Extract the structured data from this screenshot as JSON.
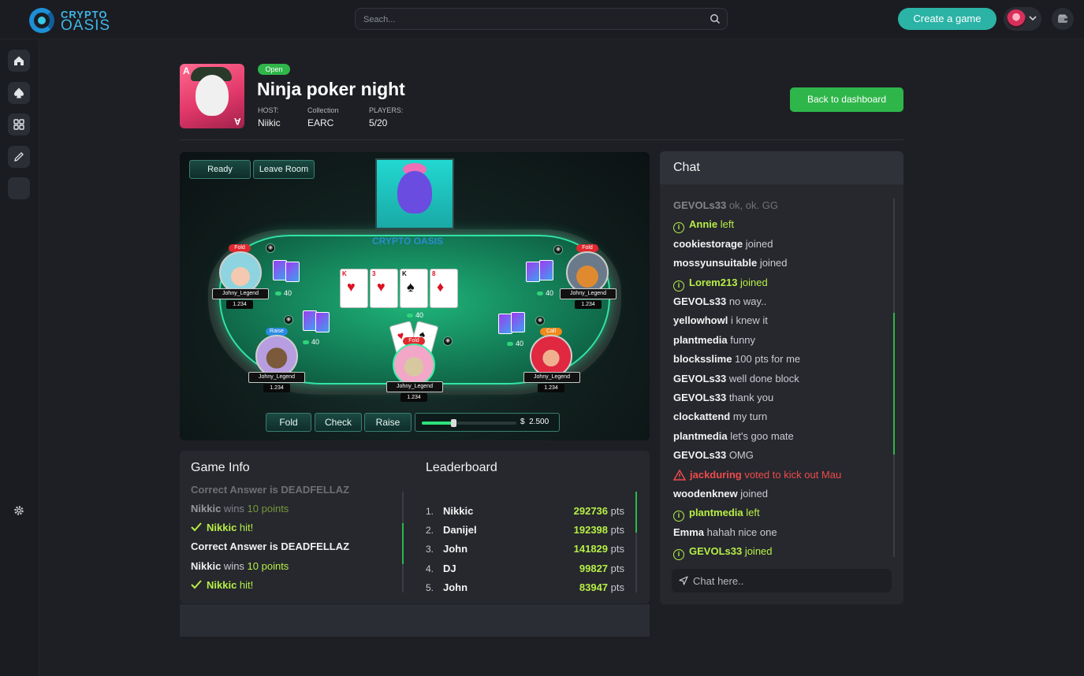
{
  "header": {
    "logo_line1": "CRYPTO",
    "logo_line2": "OASIS",
    "search_placeholder": "Seach...",
    "create_label": "Create a game",
    "icons": [
      "search-icon",
      "chevron-down-icon",
      "wallet-icon"
    ]
  },
  "sidebar": {
    "icons": [
      "home-icon",
      "spade-icon",
      "grid-icon",
      "pencil-icon",
      "blank-icon",
      "gear-icon"
    ]
  },
  "game": {
    "status": "Open",
    "title": "Ninja poker night",
    "meta": [
      {
        "key": "HOST:",
        "value": "Niikic"
      },
      {
        "key": "Collection",
        "value": "EARC"
      },
      {
        "key": "PLAYERS:",
        "value": "5/20"
      }
    ],
    "back_label": "Back to dashboard",
    "thumb_corner": "A"
  },
  "table": {
    "ready_label": "Ready",
    "leave_label": "Leave Room",
    "board_logo_1": "CRYPTO",
    "board_logo_2": "OASIS",
    "players": [
      {
        "name": "Johny_Legend",
        "score": "1.234",
        "tag": "Fold",
        "chips": "40"
      },
      {
        "name": "Johny_Legend",
        "score": "1.234",
        "tag": "Fold",
        "chips": "40"
      },
      {
        "name": "Johny_Legend",
        "score": "1.234",
        "tag": "Raise",
        "chips": "40"
      },
      {
        "name": "Johny_Legend",
        "score": "1.234",
        "tag": "Call",
        "chips": "40"
      },
      {
        "name": "Johny_Legend",
        "score": "1.234",
        "tag": "Fold"
      }
    ],
    "pot": "40",
    "actions": {
      "fold": "Fold",
      "check": "Check",
      "raise": "Raise"
    },
    "bet_currency": "$",
    "bet_value": "2.500",
    "bet_fraction": 0.33,
    "colors": {
      "fold": "#e0282e",
      "raise": "#2a8be0",
      "call": "#f08a1c"
    }
  },
  "game_info": {
    "title": "Game Info",
    "lines": [
      {
        "type": "answer",
        "text": "Correct Answer is DEADFELLAZ",
        "faded": true
      },
      {
        "type": "wins",
        "user": "Nikkic",
        "mid": " wins ",
        "pts": "10 points",
        "faded": true
      },
      {
        "type": "hit",
        "user": "Nikkic",
        "suffix": " hit!"
      },
      {
        "type": "answer",
        "text": "Correct Answer is DEADFELLAZ"
      },
      {
        "type": "wins",
        "user": "Nikkic",
        "mid": " wins ",
        "pts": "10 points"
      },
      {
        "type": "hit",
        "user": "Nikkic",
        "suffix": " hit!"
      }
    ]
  },
  "leaderboard": {
    "title": "Leaderboard",
    "unit": "pts",
    "rows": [
      {
        "rank": "1.",
        "name": "Nikkic",
        "points": "292736"
      },
      {
        "rank": "2.",
        "name": "Danijel",
        "points": "192398"
      },
      {
        "rank": "3.",
        "name": "John",
        "points": "141829"
      },
      {
        "rank": "4.",
        "name": "DJ",
        "points": "99827"
      },
      {
        "rank": "5.",
        "name": "John",
        "points": "83947"
      }
    ]
  },
  "chat": {
    "title": "Chat",
    "placeholder": "Chat here..",
    "messages": [
      {
        "user": "GEVOLs33",
        "text": " ok, ok. GG",
        "kind": "normal",
        "faded": true
      },
      {
        "user": "Annie",
        "text": " left",
        "kind": "system"
      },
      {
        "user": "cookiestorage",
        "text": " joined",
        "kind": "normal"
      },
      {
        "user": "mossyunsuitable",
        "text": " joined",
        "kind": "normal"
      },
      {
        "user": "Lorem213",
        "text": " joined",
        "kind": "system"
      },
      {
        "user": "GEVOLs33",
        "text": " no way..",
        "kind": "normal"
      },
      {
        "user": "yellowhowl",
        "text": " i knew it",
        "kind": "normal"
      },
      {
        "user": "plantmedia",
        "text": " funny",
        "kind": "normal"
      },
      {
        "user": "blocksslime",
        "text": " 100 pts for me",
        "kind": "normal"
      },
      {
        "user": "GEVOLs33",
        "text": " well done block",
        "kind": "normal"
      },
      {
        "user": "GEVOLs33",
        "text": " thank you",
        "kind": "normal"
      },
      {
        "user": "clockattend",
        "text": " my turn",
        "kind": "normal"
      },
      {
        "user": "plantmedia",
        "text": " let's goo mate",
        "kind": "normal"
      },
      {
        "user": "GEVOLs33",
        "text": " OMG",
        "kind": "normal"
      },
      {
        "user": "jackduring",
        "text": " voted to kick out Mau",
        "kind": "warning"
      },
      {
        "user": "woodenknew",
        "text": " joined",
        "kind": "normal"
      },
      {
        "user": "plantmedia",
        "text": " left",
        "kind": "system"
      },
      {
        "user": "Emma",
        "text": " hahah nice one",
        "kind": "normal"
      },
      {
        "user": "GEVOLs33",
        "text": " joined",
        "kind": "system"
      }
    ]
  }
}
